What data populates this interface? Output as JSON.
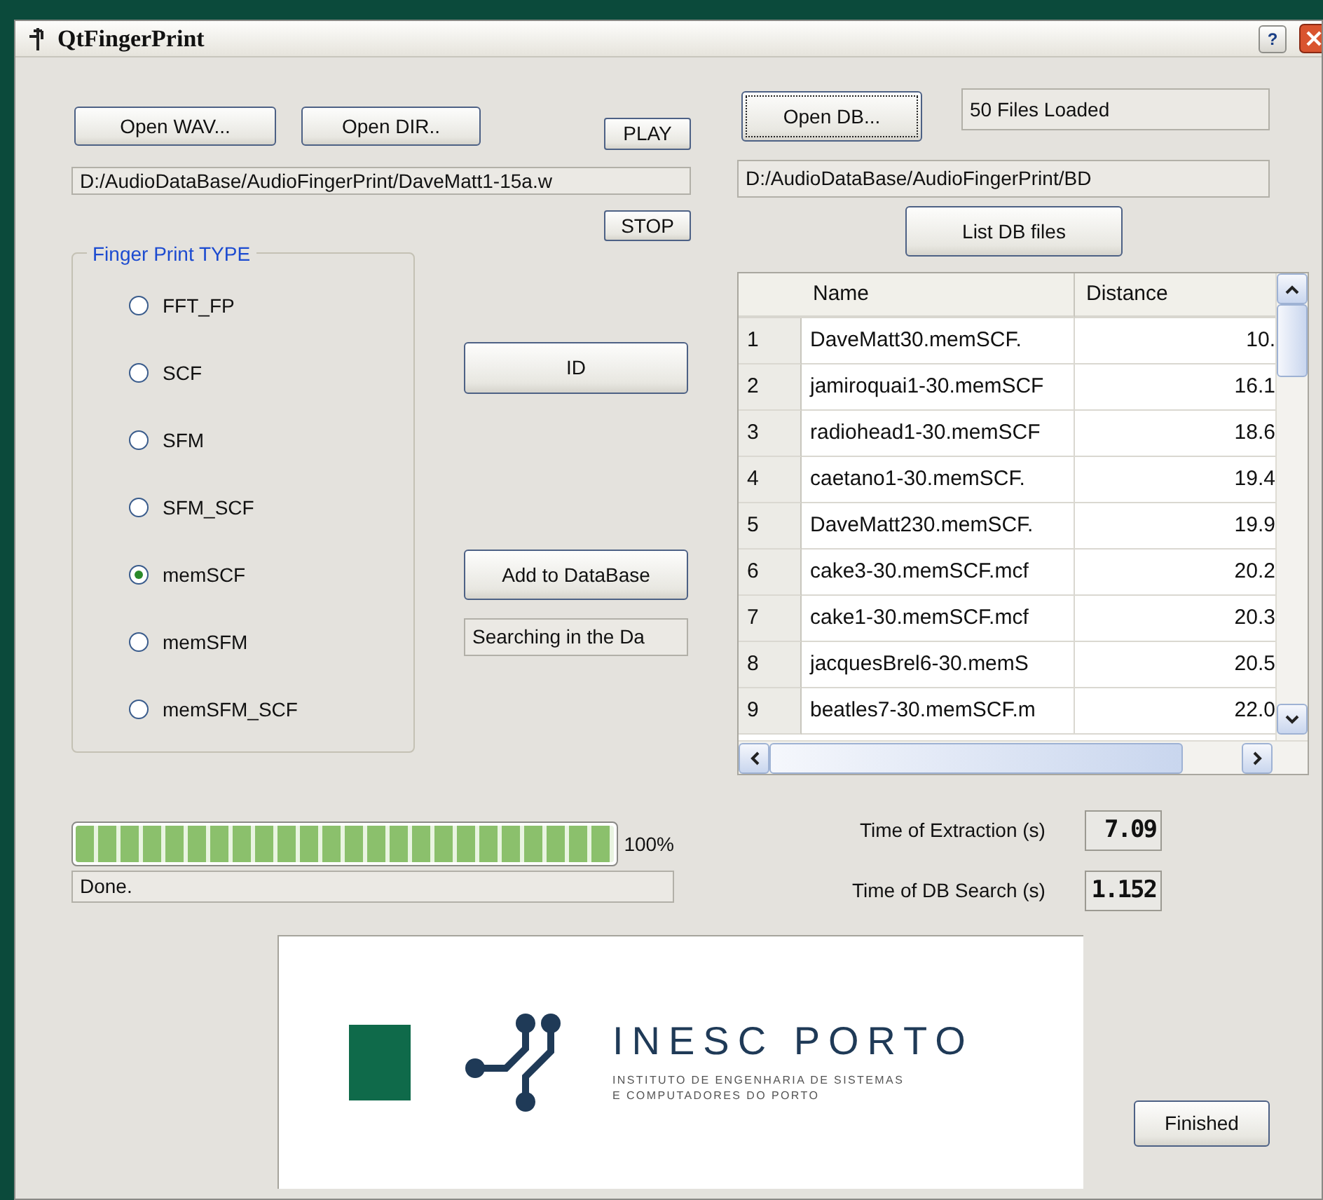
{
  "window": {
    "title": "QtFingerPrint",
    "help_button": "?"
  },
  "buttons": {
    "open_wav": {
      "label": "Open WAV...",
      "focused": false
    },
    "open_dir": {
      "label": "Open DIR..",
      "focused": false
    },
    "play": {
      "label": "PLAY",
      "focused": false
    },
    "stop": {
      "label": "STOP",
      "focused": false
    },
    "id": {
      "label": "ID",
      "focused": false
    },
    "add": {
      "label": "Add to DataBase",
      "focused": false
    },
    "open_db": {
      "label": "Open DB...",
      "focused": true
    },
    "list_db": {
      "label": "List DB files",
      "focused": false
    },
    "finished": {
      "label": "Finished",
      "focused": false
    }
  },
  "wav_path": "D:/AudioDataBase/AudioFingerPrint/DaveMatt1-15a.w",
  "search_status": "Searching in the Da",
  "db_status": "50  Files Loaded",
  "db_path": "D:/AudioDataBase/AudioFingerPrint/BD",
  "fingerprint_type": {
    "title": "Finger Print TYPE",
    "options": [
      {
        "label": "FFT_FP",
        "selected": false
      },
      {
        "label": "SCF",
        "selected": false
      },
      {
        "label": "SFM",
        "selected": false
      },
      {
        "label": "SFM_SCF",
        "selected": false
      },
      {
        "label": "memSCF",
        "selected": true
      },
      {
        "label": "memSFM",
        "selected": false
      },
      {
        "label": "memSFM_SCF",
        "selected": false
      }
    ]
  },
  "results": {
    "columns": [
      "Name",
      "Distance"
    ],
    "rows": [
      {
        "index": "1",
        "name": "DaveMatt30.memSCF.",
        "distance": "10."
      },
      {
        "index": "2",
        "name": "jamiroquai1-30.memSCF",
        "distance": "16.1"
      },
      {
        "index": "3",
        "name": "radiohead1-30.memSCF",
        "distance": "18.6"
      },
      {
        "index": "4",
        "name": "caetano1-30.memSCF.",
        "distance": "19.4"
      },
      {
        "index": "5",
        "name": "DaveMatt230.memSCF.",
        "distance": "19.9"
      },
      {
        "index": "6",
        "name": "cake3-30.memSCF.mcf",
        "distance": "20.2"
      },
      {
        "index": "7",
        "name": "cake1-30.memSCF.mcf",
        "distance": "20.3"
      },
      {
        "index": "8",
        "name": "jacquesBrel6-30.memS",
        "distance": "20.5"
      },
      {
        "index": "9",
        "name": "beatles7-30.memSCF.m",
        "distance": "22.0"
      }
    ]
  },
  "progress": {
    "level": 1,
    "reading": "100%",
    "status": "Done."
  },
  "timings": [
    {
      "label": "Time of Extraction (s)",
      "value": "7.09"
    },
    {
      "label": "Time of DB Search (s)",
      "value": "1.152"
    }
  ],
  "logo": {
    "title": "INESC PORTO",
    "subtitle_lines": [
      "INSTITUTO DE ENGENHARIA DE SISTEMAS",
      "E COMPUTADORES DO PORTO"
    ]
  }
}
